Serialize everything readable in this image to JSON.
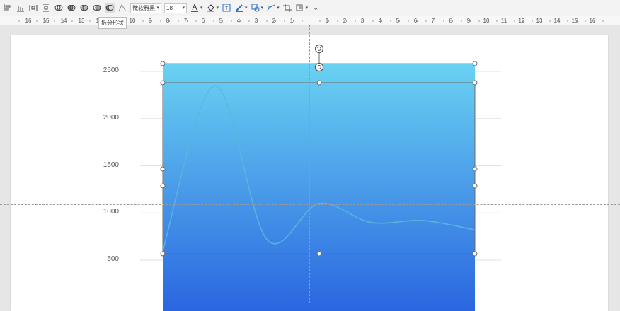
{
  "toolbar": {
    "font_name": "微软雅黑",
    "font_size": "18",
    "font_color": "#e02020",
    "fill_color": "#f0a030",
    "icons": [
      "align-left-icon",
      "align-bars-icon",
      "distribute-icon",
      "distribute-vertical-icon",
      "merge-shapes-union-icon",
      "merge-shapes-combine-icon",
      "merge-shapes-fragment-icon",
      "merge-shapes-intersect-icon",
      "merge-shapes-subtract-icon",
      "edit-points-icon",
      "font-color-icon",
      "fill-color-icon",
      "text-box-icon",
      "outline-icon",
      "shape-icon",
      "effects-icon",
      "crop-icon",
      "arrange-icon",
      "more-icon"
    ]
  },
  "tooltip": {
    "text": "拆分形状"
  },
  "ruler": {
    "left_labels": [
      "16",
      "15",
      "14",
      "13",
      "12"
    ],
    "mid_labels": [
      "10",
      "9",
      "8",
      "7",
      "6",
      "5",
      "4",
      "3",
      "2",
      "1"
    ],
    "right_labels": [
      "1",
      "2",
      "3",
      "4",
      "5",
      "6",
      "7",
      "8",
      "9",
      "10",
      "11",
      "12",
      "13",
      "14",
      "15",
      "16"
    ]
  },
  "chart_data": {
    "type": "area",
    "categories": [],
    "y_axis_ticks": [
      "2500",
      "2000",
      "1500",
      "1000",
      "500"
    ],
    "ylim": [
      0,
      2600
    ],
    "series": [
      {
        "values": [
          600,
          2350,
          720,
          1100,
          900,
          920,
          820
        ]
      }
    ],
    "gradient_top": "#6ad2f2",
    "gradient_bottom": "#2a66e0",
    "line_color": "#5ab7dd",
    "gridlines": true
  }
}
